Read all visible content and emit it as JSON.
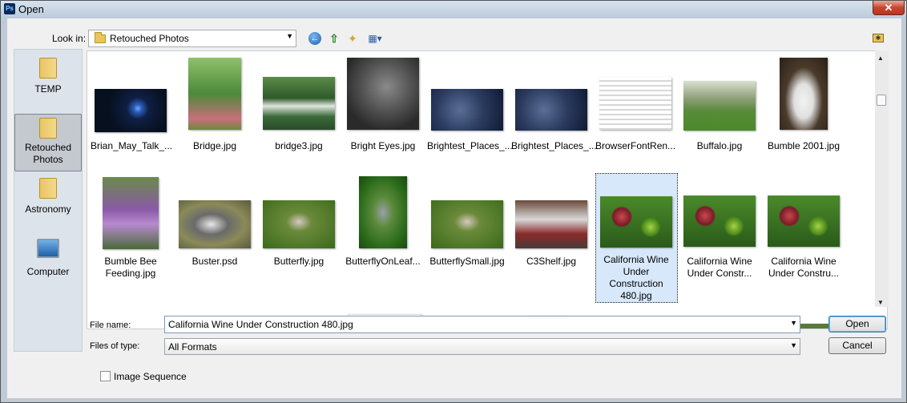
{
  "window": {
    "title": "Open",
    "app_icon_text": "Ps"
  },
  "toolbar": {
    "look_in_label": "Look in:",
    "look_in_value": "Retouched Photos",
    "icons": [
      "back-icon",
      "up-folder-icon",
      "new-folder-icon",
      "view-menu-icon",
      "favorite-folder-icon"
    ]
  },
  "places": [
    {
      "label": "TEMP",
      "icon": "folder-icon",
      "selected": false
    },
    {
      "label": "Retouched Photos",
      "icon": "folder-icon",
      "selected": true
    },
    {
      "label": "Astronomy",
      "icon": "folder-icon",
      "selected": false
    },
    {
      "label": "Computer",
      "icon": "computer-icon",
      "selected": false
    }
  ],
  "files_row1": [
    {
      "name": "Brian_May_Talk_..."
    },
    {
      "name": "Bridge.jpg"
    },
    {
      "name": "bridge3.jpg"
    },
    {
      "name": "Bright Eyes.jpg"
    },
    {
      "name": "Brightest_Places_..."
    },
    {
      "name": "Brightest_Places_..."
    },
    {
      "name": "BrowserFontRen..."
    },
    {
      "name": "Buffalo.jpg"
    },
    {
      "name": "Bumble 2001.jpg"
    }
  ],
  "files_row2": [
    {
      "name": "Bumble Bee Feeding.jpg"
    },
    {
      "name": "Buster.psd"
    },
    {
      "name": "Butterfly.jpg"
    },
    {
      "name": "ButterflyOnLeaf..."
    },
    {
      "name": "ButterflySmall.jpg"
    },
    {
      "name": "C3Shelf.jpg"
    },
    {
      "name": "California Wine Under Construction 480.jpg"
    },
    {
      "name": "California Wine Under Constr..."
    },
    {
      "name": "California Wine Under Constru..."
    }
  ],
  "form": {
    "file_name_label": "File name:",
    "file_name_value": "California Wine Under Construction 480.jpg",
    "files_of_type_label": "Files of type:",
    "files_of_type_value": "All Formats",
    "open_label": "Open",
    "cancel_label": "Cancel",
    "image_sequence_label": "Image Sequence",
    "image_sequence_checked": false
  },
  "colors": {
    "selection": "#d8e8fb",
    "title_bar": "#bccbdb",
    "close": "#c8452f"
  }
}
